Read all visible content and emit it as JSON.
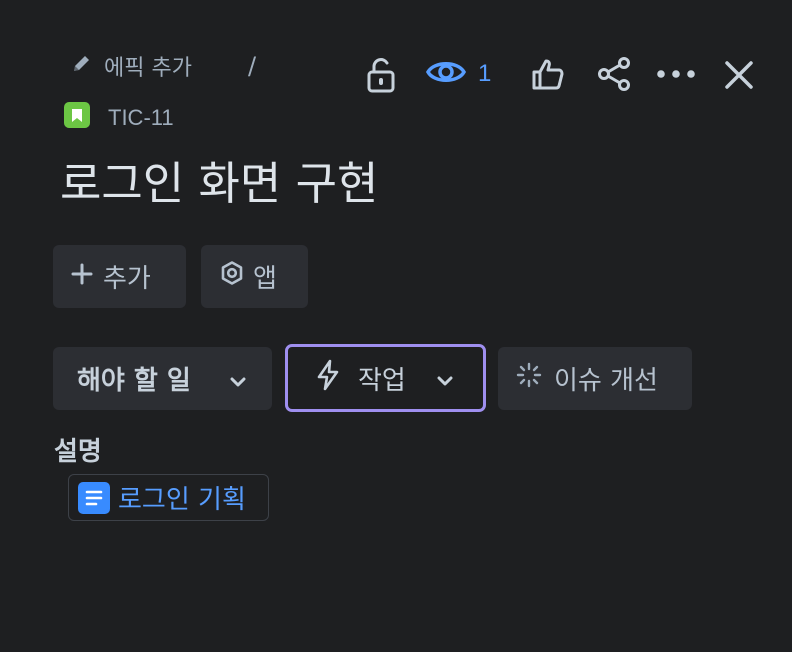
{
  "breadcrumb": {
    "add_epic_label": "에픽 추가",
    "separator": "/"
  },
  "toolbar": {
    "watch_count": "1",
    "icons": [
      "unlock-icon",
      "eye-icon",
      "thumbs-up-icon",
      "share-icon",
      "more-icon",
      "close-icon"
    ]
  },
  "issue": {
    "key": "TIC-11",
    "title": "로그인 화면 구현",
    "type_color": "#6cc644"
  },
  "actions": {
    "add_label": "추가",
    "apps_label": "앱"
  },
  "status": {
    "label": "해야 할 일"
  },
  "work_type": {
    "label": "작업",
    "accent": "#9f8fef"
  },
  "improve": {
    "label": "이슈 개선"
  },
  "description": {
    "heading": "설명",
    "linked_doc_label": "로그인 기획",
    "link_color": "#579dff"
  }
}
